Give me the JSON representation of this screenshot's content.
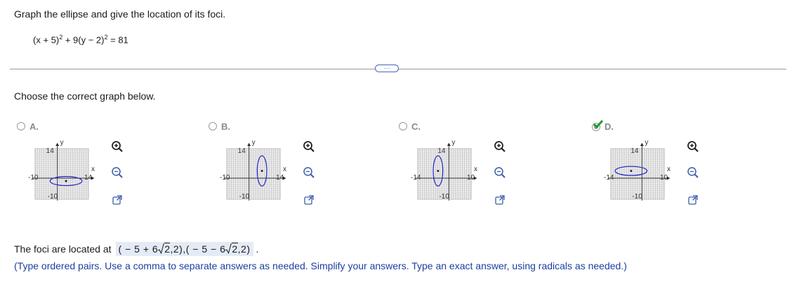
{
  "question": {
    "text": "Graph the ellipse and give the location of its foci.",
    "equation": {
      "part1": "(x + 5)",
      "part2": " + 9(y − 2)",
      "part3": " = 81",
      "exp": "2"
    }
  },
  "more_label": "···",
  "prompt": "Choose the correct graph below.",
  "options": [
    {
      "label": "A.",
      "selected": false,
      "ymax": "14",
      "ymin": "-10",
      "xmin": "-10",
      "xmax": "14",
      "xvar": "x",
      "yvar": "y"
    },
    {
      "label": "B.",
      "selected": false,
      "ymax": "14",
      "ymin": "-10",
      "xmin": "-10",
      "xmax": "14",
      "xvar": "x",
      "yvar": "y"
    },
    {
      "label": "C.",
      "selected": false,
      "ymax": "14",
      "ymin": "-10",
      "xmin": "-14",
      "xmax": "10",
      "xvar": "x",
      "yvar": "y"
    },
    {
      "label": "D.",
      "selected": true,
      "ymax": "14",
      "ymin": "-10",
      "xmin": "-14",
      "xmax": "10",
      "xvar": "x",
      "yvar": "y"
    }
  ],
  "answer": {
    "prefix": "The foci are located at",
    "value_parts": [
      "( − 5 + 6",
      "2",
      ",2),( − 5 − 6",
      "2",
      ",2)"
    ],
    "suffix": "."
  },
  "hint": "(Type ordered pairs. Use a comma to separate answers as needed. Simplify your answers. Type an exact answer, using radicals as needed.)",
  "colors": {
    "ellipse": "#2222cc",
    "check": "#1f9e2c",
    "link": "#1c3fa0",
    "answer_bg": "#e4ebf7"
  },
  "icons": [
    "zoom-in-icon",
    "zoom-out-icon",
    "popout-icon",
    "checkmark-icon"
  ]
}
